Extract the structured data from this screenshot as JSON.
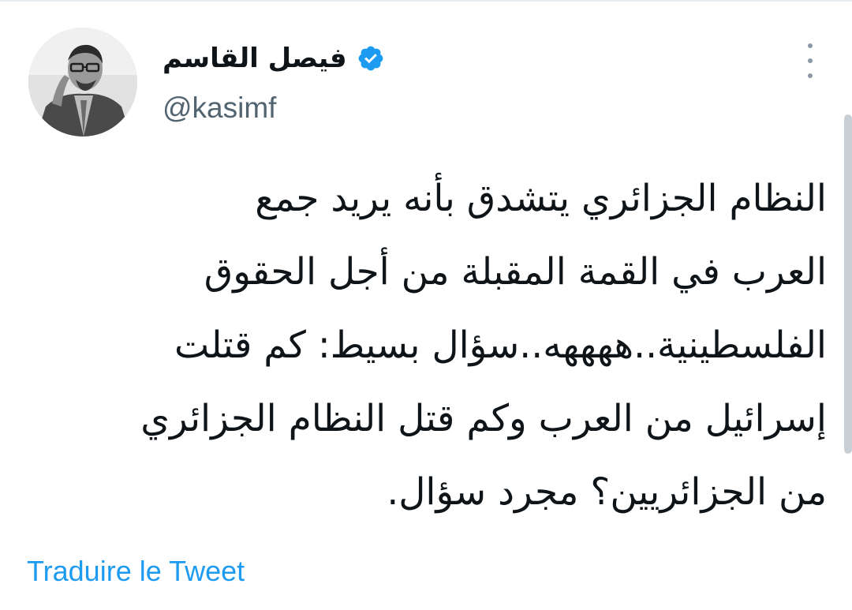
{
  "author": {
    "display_name": "فيصل القاسم",
    "handle": "@kasimf",
    "verified": true,
    "verified_icon": "verified-badge-icon",
    "avatar": "profile-photo"
  },
  "tweet": {
    "lines": [
      "النظام الجزائري يتشدق بأنه يريد جمع",
      "العرب في القمة المقبلة من أجل الحقوق",
      "الفلسطينية..ههههه..سؤال بسيط: كم قتلت",
      "إسرائيل من العرب وكم قتل النظام الجزائري",
      "من الجزائريين؟ مجرد سؤال."
    ]
  },
  "actions": {
    "more_icon": "more-options-icon",
    "translate_label": "Traduire le Tweet"
  },
  "colors": {
    "link": "#1d9bf0",
    "handle": "#536471",
    "text": "#0f1419",
    "verified": "#1d9bf0"
  }
}
